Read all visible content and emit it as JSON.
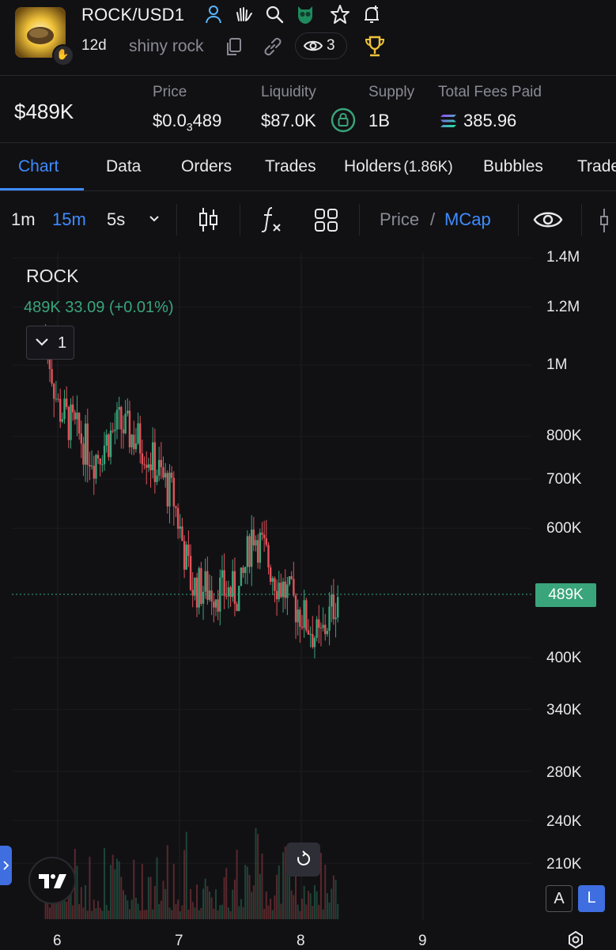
{
  "header": {
    "pair": "ROCK/USD1",
    "age": "12d",
    "token_name": "shiny rock",
    "watchers": "3",
    "icons": [
      "user-icon",
      "hand-wave-icon",
      "search-icon",
      "owl-icon",
      "star-icon",
      "bell-plus-icon",
      "copy-icon",
      "link-icon",
      "eye-icon",
      "trophy-icon"
    ]
  },
  "stats": {
    "market_cap": "$489K",
    "price_label": "Price",
    "price_prefix": "$0.0",
    "price_subscript": "3",
    "price_suffix": "489",
    "liquidity_label": "Liquidity",
    "liquidity_value": "$87.0K",
    "supply_label": "Supply",
    "supply_value": "1B",
    "fees_label": "Total Fees Paid",
    "fees_value": "385.96"
  },
  "tabs": [
    {
      "label": "Chart",
      "active": true
    },
    {
      "label": "Data"
    },
    {
      "label": "Orders"
    },
    {
      "label": "Trades"
    },
    {
      "label": "Holders",
      "count": "(1.86K)"
    },
    {
      "label": "Bubbles"
    },
    {
      "label": "Trade"
    }
  ],
  "toolbar": {
    "intervals": [
      "1m",
      "15m",
      "5s"
    ],
    "active_interval": "15m",
    "price_toggle": "Price",
    "slash": "/",
    "mcap_toggle": "MCap"
  },
  "legend": {
    "symbol": "ROCK",
    "values": "489K  33.09 (+0.01%)",
    "collapse_count": "1"
  },
  "chart_data": {
    "type": "candlestick",
    "title": "ROCK",
    "y_axis_scale": "log",
    "y_ticks": [
      "1.4M",
      "1.2M",
      "1M",
      "800K",
      "700K",
      "600K",
      "400K",
      "340K",
      "280K",
      "240K",
      "210K"
    ],
    "x_ticks": [
      "6",
      "7",
      "8",
      "9"
    ],
    "last_value_label": "489K",
    "approx_path": [
      {
        "x": 5.9,
        "mcap": 1100000
      },
      {
        "x": 6.0,
        "mcap": 880000
      },
      {
        "x": 6.3,
        "mcap": 750000
      },
      {
        "x": 6.5,
        "mcap": 830000
      },
      {
        "x": 6.7,
        "mcap": 780000
      },
      {
        "x": 6.95,
        "mcap": 660000
      },
      {
        "x": 7.1,
        "mcap": 500000
      },
      {
        "x": 7.5,
        "mcap": 490000
      },
      {
        "x": 7.6,
        "mcap": 600000
      },
      {
        "x": 7.8,
        "mcap": 510000
      },
      {
        "x": 8.0,
        "mcap": 460000
      },
      {
        "x": 8.15,
        "mcap": 420000
      },
      {
        "x": 8.3,
        "mcap": 489000
      }
    ],
    "colors": {
      "up": "#3aa57a",
      "down": "#e0535a"
    },
    "grid": true
  },
  "controls": {
    "auto_label": "A",
    "log_label": "L"
  }
}
